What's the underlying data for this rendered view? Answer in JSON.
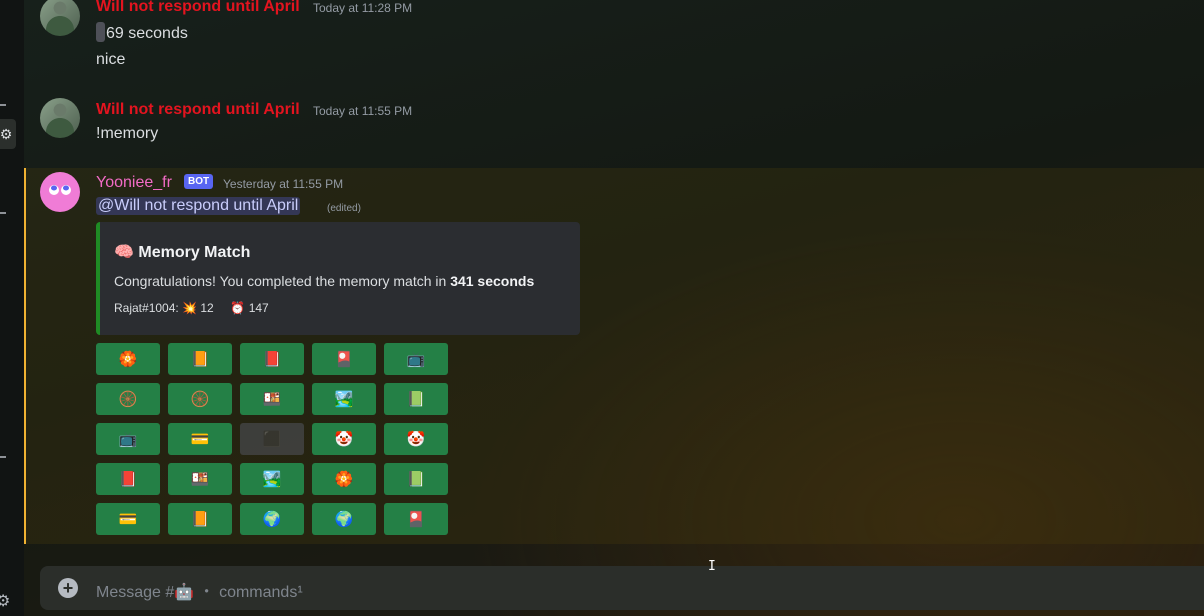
{
  "messages": [
    {
      "author": "Will not respond until April",
      "timestamp": "Today at 11:28 PM",
      "lines": [
        "69 seconds",
        "nice"
      ]
    },
    {
      "author": "Will not respond until April",
      "timestamp": "Today at 11:55 PM",
      "lines": [
        "!memory"
      ]
    }
  ],
  "bot_message": {
    "author": "Yooniee_fr",
    "badge": "BOT",
    "timestamp": "Yesterday at 11:55 PM",
    "mention": "@Will not respond until April",
    "edited": "(edited)",
    "embed": {
      "title": "Memory Match",
      "title_emoji": "🧠",
      "description_prefix": "Congratulations! You completed the memory match in",
      "description_bold": "341 seconds",
      "footer_user": "Rajat#1004:",
      "moves_emoji": "💥",
      "moves": "12",
      "time_emoji": "⏰",
      "time": "147",
      "accent_color": "#1f8b24"
    },
    "buttons": [
      [
        "🏵️",
        "📙",
        "📕",
        "🎴",
        "📺"
      ],
      [
        "🛞",
        "🛞",
        "🍱",
        "🏞️",
        "📗"
      ],
      [
        "📺",
        "💳",
        "⬛",
        "🤡",
        "🤡"
      ],
      [
        "📕",
        "🍱",
        "🏞️",
        "🏵️",
        "📗"
      ],
      [
        "💳",
        "📙",
        "🌍",
        "🌍",
        "🎴"
      ]
    ],
    "disabled_button": [
      2,
      2
    ]
  },
  "composer": {
    "placeholder": "Message #🤖 ・ commands¹"
  },
  "colors": {
    "author_red": "#e3141f",
    "bot_pink": "#f26bc6",
    "button_green": "#248046",
    "highlight_gold": "#f0b232"
  },
  "icons": {
    "add": "plus-circle-icon",
    "settings": "gear-icon"
  }
}
